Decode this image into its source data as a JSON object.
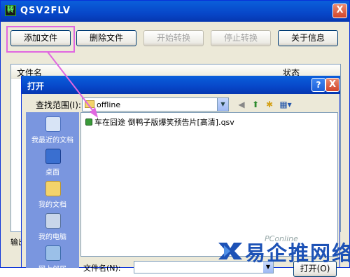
{
  "main_window": {
    "title": "QSV2FLV",
    "app_icon_glyph": "转",
    "close_glyph": "X"
  },
  "toolbar": {
    "add_file": "添加文件",
    "delete_file": "删除文件",
    "start_convert": "开始转换",
    "stop_convert": "停止转换",
    "about": "关于信息"
  },
  "file_list": {
    "col_filename": "文件名",
    "col_status": "状态"
  },
  "output_label": "输出",
  "open_dialog": {
    "title": "打开",
    "help_glyph": "?",
    "close_glyph": "X",
    "look_in_label": "查找范围(I):",
    "look_in_value": "offline",
    "places": [
      {
        "label": "我最近的文档",
        "icon": "recent-documents-icon"
      },
      {
        "label": "桌面",
        "icon": "desktop-icon"
      },
      {
        "label": "我的文档",
        "icon": "my-documents-icon"
      },
      {
        "label": "我的电脑",
        "icon": "my-computer-icon"
      },
      {
        "label": "网上邻居",
        "icon": "network-places-icon"
      }
    ],
    "files": [
      {
        "name": "车在囧途 倒鸭子版爆笑预告片[高清].qsv"
      }
    ],
    "filename_label": "文件名(N):",
    "filename_value": "",
    "open_button": "打开(O)"
  },
  "watermark": {
    "text": "易企推网络",
    "small_text": "PConline"
  },
  "colors": {
    "highlight_box": "#e067e0",
    "titlebar": "#0747c9",
    "places_bar": "#7a96df"
  }
}
